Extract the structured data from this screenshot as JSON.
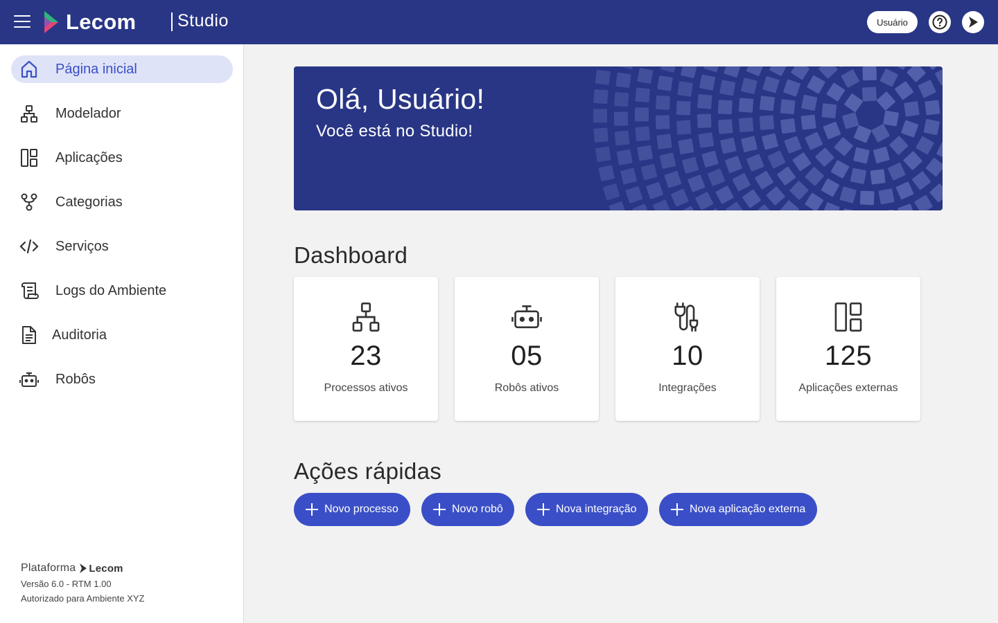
{
  "header": {
    "menu_icon": "hamburger-menu-icon",
    "logo_text": "Lecom",
    "app_name": "Studio",
    "user_label": "Usuário",
    "help_icon": "help-circle-icon",
    "profile_icon": "lecom-arrow-icon",
    "bar_color": "#293685"
  },
  "sidebar": {
    "items": [
      {
        "label": "Página inicial",
        "icon": "home-icon",
        "active": true
      },
      {
        "label": "Modelador",
        "icon": "hierarchy-icon"
      },
      {
        "label": "Aplicações",
        "icon": "layout-icon"
      },
      {
        "label": "Categorias",
        "icon": "category-branch-icon"
      },
      {
        "label": "Serviços",
        "icon": "code-icon"
      },
      {
        "label": "Logs do Ambiente",
        "icon": "scroll-log-icon"
      },
      {
        "label": "Auditoria",
        "icon": "document-icon"
      },
      {
        "label": "Robôs",
        "icon": "robot-icon"
      }
    ],
    "footer": {
      "platform_label": "Plataforma",
      "brand": "Lecom",
      "version": "Versão 6.0 - RTM 1.00",
      "authorized": "Autorizado para Ambiente XYZ"
    }
  },
  "banner": {
    "greeting": "Olá, Usuário!",
    "subtitle": "Você está no Studio!"
  },
  "dashboard": {
    "title": "Dashboard",
    "cards": [
      {
        "value": "23",
        "label": "Processos ativos",
        "icon": "hierarchy-icon"
      },
      {
        "value": "05",
        "label": "Robôs ativos",
        "icon": "robot-icon"
      },
      {
        "value": "10",
        "label": "Integrações",
        "icon": "plug-cable-icon"
      },
      {
        "value": "125",
        "label": "Aplicações externas",
        "icon": "layout-icon"
      }
    ]
  },
  "quick_actions": {
    "title": "Ações rápidas",
    "buttons": [
      {
        "label": "Novo processo",
        "icon": "plus-icon"
      },
      {
        "label": "Novo robô",
        "icon": "plus-icon"
      },
      {
        "label": "Nova integração",
        "icon": "plus-icon"
      },
      {
        "label": "Nova aplicação externa",
        "icon": "plus-icon"
      }
    ],
    "accent": "#3a4fc7"
  }
}
